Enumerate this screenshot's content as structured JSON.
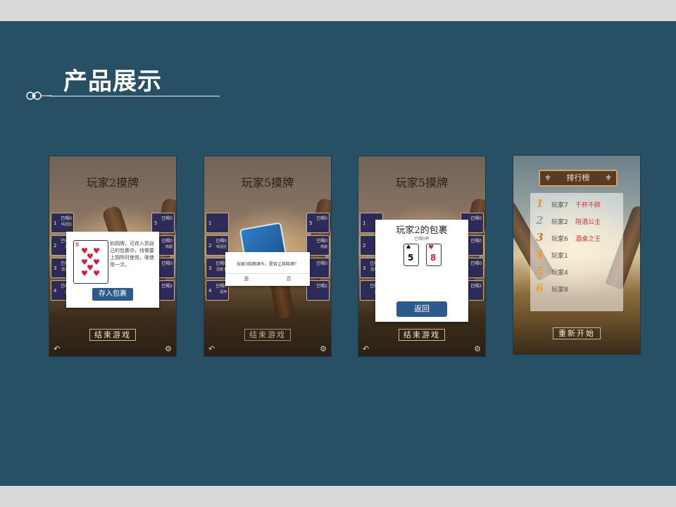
{
  "slide": {
    "title": "产品展示"
  },
  "phones": [
    {
      "title": "玩家2摸牌",
      "left_slots": [
        {
          "n": "1",
          "t": "已喝0",
          "s": "喝酒狂"
        },
        {
          "n": "2",
          "t": "已喝0",
          "s": "酒鬼"
        },
        {
          "n": "3",
          "t": "已喝0",
          "s": "酒量王"
        },
        {
          "n": "4",
          "t": "已喝0",
          "s": "酒神"
        }
      ],
      "right_slots": [
        {
          "n": "5",
          "t": "已喝0",
          "s": ""
        },
        {
          "n": "",
          "t": "已喝0",
          "s": "微醺"
        },
        {
          "n": "",
          "t": "已喝0",
          "s": ""
        },
        {
          "n": "",
          "t": "已喝2",
          "s": ""
        }
      ],
      "dialog": {
        "text": "如厕牌，可存入到自己的包裹中，待需要上厕所时使用，限使用一次。",
        "button": "存入包裹",
        "card_rank": "8"
      },
      "end_button": "结束游戏"
    },
    {
      "title": "玩家5摸牌",
      "left_slots": [
        {
          "n": "1",
          "t": "",
          "s": ""
        },
        {
          "n": "2",
          "t": "已喝0",
          "s": "喝酒狂"
        },
        {
          "n": "3",
          "t": "已喝0",
          "s": "酒量王"
        },
        {
          "n": "4",
          "t": "已喝0",
          "s": "酒神"
        }
      ],
      "right_slots": [
        {
          "n": "5",
          "t": "已喝0",
          "s": ""
        },
        {
          "n": "",
          "t": "已喝0",
          "s": "微醺"
        },
        {
          "n": "",
          "t": "已喝0",
          "s": ""
        },
        {
          "n": "",
          "t": "已喝2",
          "s": ""
        }
      ],
      "dialog": {
        "text": "玩家3陪随酒卡，是否让其陪酒？",
        "yes": "是",
        "no": "否"
      },
      "end_button": "结束游戏"
    },
    {
      "title": "玩家5摸牌",
      "left_slots": [
        {
          "n": "1",
          "t": "",
          "s": ""
        },
        {
          "n": "2",
          "t": "",
          "s": ""
        },
        {
          "n": "3",
          "t": "已喝0",
          "s": "酒量王"
        },
        {
          "n": "",
          "t": "已喝0",
          "s": "酒神"
        }
      ],
      "right_slots": [
        {
          "n": "",
          "t": "已喝0",
          "s": ""
        },
        {
          "n": "",
          "t": "已喝0",
          "s": ""
        },
        {
          "n": "",
          "t": "已喝0",
          "s": ""
        },
        {
          "n": "",
          "t": "已喝2",
          "s": ""
        }
      ],
      "dialog": {
        "title": "玩家2的包裹",
        "sub": "已喝0杯",
        "card1": "5",
        "card2": "8",
        "button": "返回"
      },
      "end_button": "结束游戏"
    }
  ],
  "leaderboard": {
    "title": "排行榜",
    "rows": [
      {
        "rank": "1",
        "name": "玩家7",
        "tag": "千杯不醉"
      },
      {
        "rank": "2",
        "name": "玩家2",
        "tag": "陪酒公主"
      },
      {
        "rank": "3",
        "name": "玩家6",
        "tag": "酒桌之王"
      },
      {
        "rank": "4",
        "name": "玩家1",
        "tag": ""
      },
      {
        "rank": "5",
        "name": "玩家4",
        "tag": ""
      },
      {
        "rank": "6",
        "name": "玩家8",
        "tag": ""
      }
    ],
    "restart_button": "重新开始"
  }
}
